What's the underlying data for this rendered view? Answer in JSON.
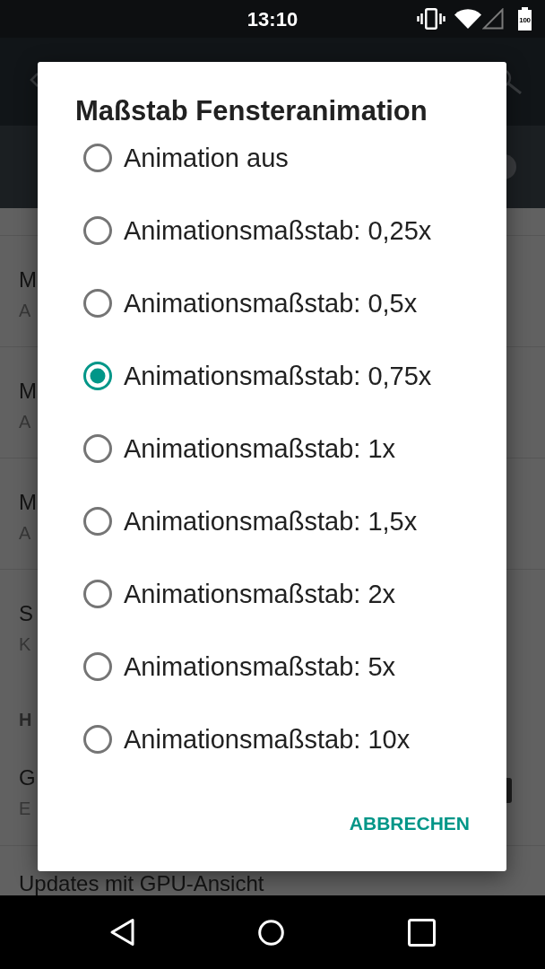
{
  "status_bar": {
    "time": "13:10",
    "battery": "100"
  },
  "background": {
    "list": [
      {
        "kind": "item",
        "title": "M",
        "summary": "A"
      },
      {
        "kind": "item",
        "title": "M",
        "summary": "A"
      },
      {
        "kind": "item",
        "title": "M",
        "summary": "A"
      },
      {
        "kind": "item",
        "title": "S",
        "summary": "K"
      },
      {
        "kind": "header",
        "title": "H"
      },
      {
        "kind": "switch_item",
        "title": "G",
        "summary": "E"
      },
      {
        "kind": "item",
        "title": "Updates mit GPU-Ansicht"
      }
    ]
  },
  "dialog": {
    "title": "Maßstab Fensteranimation",
    "options": [
      {
        "label": "Animation aus",
        "selected": false
      },
      {
        "label": "Animationsmaßstab: 0,25x",
        "selected": false
      },
      {
        "label": "Animationsmaßstab: 0,5x",
        "selected": false
      },
      {
        "label": "Animationsmaßstab: 0,75x",
        "selected": true
      },
      {
        "label": "Animationsmaßstab: 1x",
        "selected": false
      },
      {
        "label": "Animationsmaßstab: 1,5x",
        "selected": false
      },
      {
        "label": "Animationsmaßstab: 2x",
        "selected": false
      },
      {
        "label": "Animationsmaßstab: 5x",
        "selected": false
      },
      {
        "label": "Animationsmaßstab: 10x",
        "selected": false
      }
    ],
    "buttons": [
      "ABBRECHEN"
    ]
  }
}
